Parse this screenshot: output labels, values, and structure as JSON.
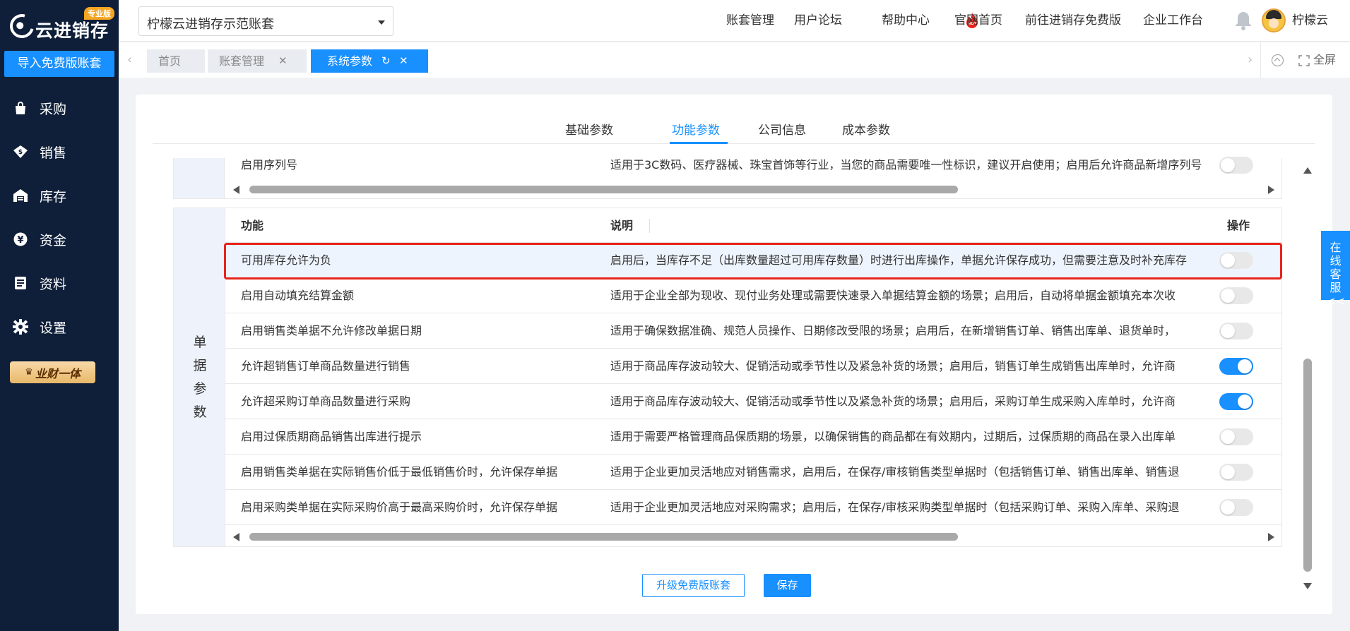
{
  "brand": {
    "logo_text": "云进销存",
    "edition_badge": "专业版",
    "accent_color": "#1890ff",
    "sidebar_bg": "#0f1f3a"
  },
  "sidebar": {
    "import_button": "导入免费版账套",
    "items": [
      {
        "label": "采购",
        "icon": "shopping-bag-icon"
      },
      {
        "label": "销售",
        "icon": "sales-tag-icon"
      },
      {
        "label": "库存",
        "icon": "warehouse-icon"
      },
      {
        "label": "资金",
        "icon": "yen-coin-icon"
      },
      {
        "label": "资料",
        "icon": "document-icon"
      },
      {
        "label": "设置",
        "icon": "gear-icon"
      }
    ],
    "vip_badge": "业财一体"
  },
  "header": {
    "account_select_value": "柠檬云进销存示范账套",
    "nav": [
      "账套管理",
      "用户论坛",
      "帮助中心",
      "官网首页",
      "前往进销存免费版",
      "企业工作台"
    ],
    "hot_badge": "HOT",
    "username": "柠檬云"
  },
  "tabs": {
    "items": [
      {
        "label": "首页",
        "active": false,
        "closable": false
      },
      {
        "label": "账套管理",
        "active": false,
        "closable": true
      },
      {
        "label": "系统参数",
        "active": true,
        "closable": true
      }
    ],
    "fullscreen_label": "全屏"
  },
  "page": {
    "param_tabs": [
      "基础参数",
      "功能参数",
      "公司信息",
      "成本参数"
    ],
    "active_param_tab": "功能参数",
    "top_table_row": {
      "feature": "启用序列号",
      "description": "适用于3C数码、医疗器械、珠宝首饰等行业，当您的商品需要唯一性标识，建议开启使用；启用后允许商品新增序列号",
      "enabled": false
    },
    "table": {
      "group_label": [
        "单",
        "据",
        "参",
        "数"
      ],
      "headers": {
        "feature": "功能",
        "description": "说明",
        "action": "操作"
      },
      "rows": [
        {
          "feature": "可用库存允许为负",
          "description": "启用后，当库存不足（出库数量超过可用库存数量）时进行出库操作，单据允许保存成功，但需要注意及时补充库存",
          "enabled": false
        },
        {
          "feature": "启用自动填充结算金额",
          "description": "适用于企业全部为现收、现付业务处理或需要快速录入单据结算金额的场景；启用后，自动将单据金额填充本次收",
          "enabled": false
        },
        {
          "feature": "启用销售类单据不允许修改单据日期",
          "description": "适用于确保数据准确、规范人员操作、日期修改受限的场景；启用后，在新增销售订单、销售出库单、退货单时，",
          "enabled": false
        },
        {
          "feature": "允许超销售订单商品数量进行销售",
          "description": "适用于商品库存波动较大、促销活动或季节性以及紧急补货的场景；启用后，销售订单生成销售出库单时，允许商",
          "enabled": true
        },
        {
          "feature": "允许超采购订单商品数量进行采购",
          "description": "适用于商品库存波动较大、促销活动或季节性以及紧急补货的场景；启用后，采购订单生成采购入库单时，允许商",
          "enabled": true
        },
        {
          "feature": "启用过保质期商品销售出库进行提示",
          "description": "适用于需要严格管理商品保质期的场景，以确保销售的商品都在有效期内，过期后，过保质期的商品在录入出库单",
          "enabled": false
        },
        {
          "feature": "启用销售类单据在实际销售价低于最低销售价时，允许保存单据",
          "description": "适用于企业更加灵活地应对销售需求，启用后，在保存/审核销售类型单据时（包括销售订单、销售出库单、销售退",
          "enabled": false
        },
        {
          "feature": "启用采购类单据在实际采购价高于最高采购价时，允许保存单据",
          "description": "适用于企业更加灵活地应对采购需求；启用后，在保存/审核采购类型单据时（包括采购订单、采购入库单、采购退",
          "enabled": false
        }
      ]
    },
    "buttons": {
      "upgrade": "升级免费版账套",
      "save": "保存"
    }
  },
  "float_service": [
    "在",
    "线",
    "客",
    "服",
    "<<"
  ]
}
